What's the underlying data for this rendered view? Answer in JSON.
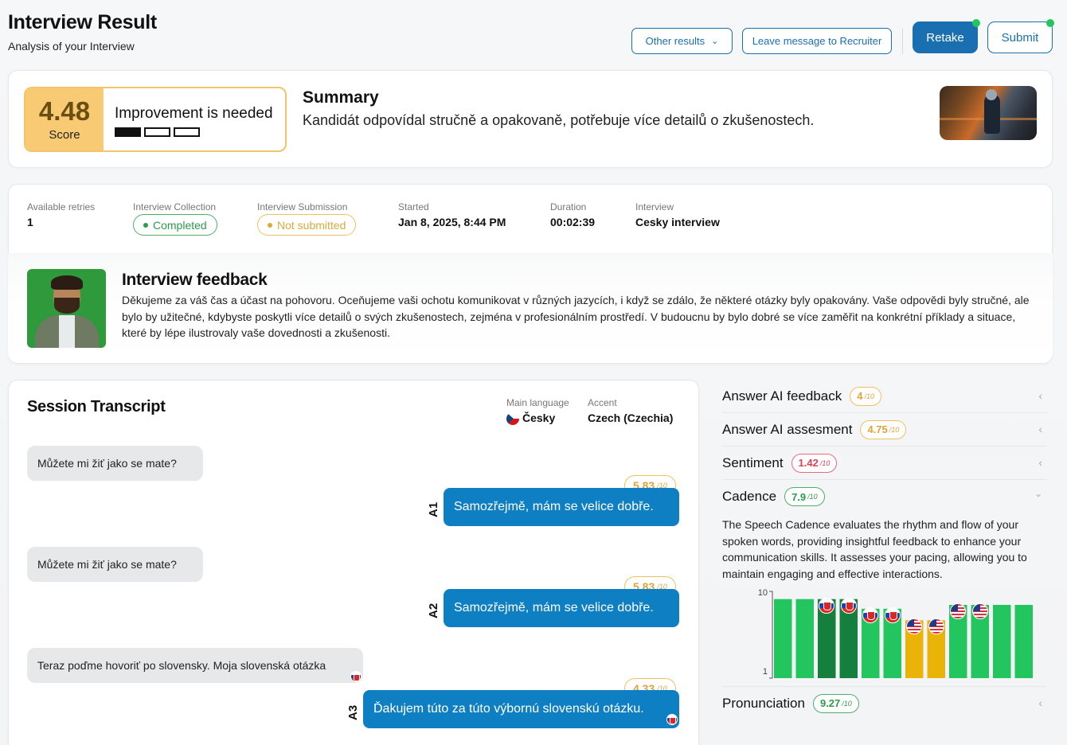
{
  "header": {
    "title": "Interview Result",
    "subtitle": "Analysis of your Interview",
    "other_results": "Other results",
    "leave_message": "Leave message to Recruiter",
    "retake": "Retake",
    "submit": "Submit"
  },
  "score": {
    "value": "4.48",
    "label": "Score",
    "status": "Improvement is needed",
    "level_filled": 1,
    "level_total": 3
  },
  "summary": {
    "title": "Summary",
    "text": "Kandidát odpovídal stručně a opakovaně, potřebuje více detailů o zkušenostech."
  },
  "meta": {
    "retries_label": "Available retries",
    "retries_value": "1",
    "collection_label": "Interview Collection",
    "collection_value": "Completed",
    "submission_label": "Interview Submission",
    "submission_value": "Not submitted",
    "started_label": "Started",
    "started_value": "Jan 8, 2025, 8:44 PM",
    "duration_label": "Duration",
    "duration_value": "00:02:39",
    "interview_label": "Interview",
    "interview_value": "Cesky interview"
  },
  "feedback": {
    "title": "Interview feedback",
    "text": "Děkujeme za váš čas a účast na pohovoru. Oceňujeme vaši ochotu komunikovat v různých jazycích, i když se zdálo, že některé otázky byly opakovány. Vaše odpovědi byly stručné, ale bylo by užitečné, kdybyste poskytli více detailů o svých zkušenostech, zejména v profesionálním prostředí. V budoucnu by bylo dobré se více zaměřit na konkrétní příklady a situace, které by lépe ilustrovaly vaše dovednosti a zkušenosti."
  },
  "transcript": {
    "title": "Session Transcript",
    "main_language_label": "Main language",
    "main_language_value": "Česky",
    "accent_label": "Accent",
    "accent_value": "Czech (Czechia)",
    "items": [
      {
        "question": "Můžete mi žiť jako se mate?",
        "answer_label": "A1",
        "answer": "Samozřejmě, mám se velice dobře.",
        "score": "5.83",
        "score_unit": "/10"
      },
      {
        "question": "Můžete mi žiť jako se mate?",
        "answer_label": "A2",
        "answer": "Samozřejmě, mám se velice dobře.",
        "score": "5.83",
        "score_unit": "/10"
      },
      {
        "question": "Teraz poďme hovoriť po slovensky. Moja slovenská otázka",
        "answer_label": "A3",
        "answer": "Ďakujem túto za túto výbornú slovenskú otázku.",
        "score": "4.33",
        "score_unit": "/10"
      }
    ]
  },
  "metrics": {
    "answer_feedback": {
      "label": "Answer AI feedback",
      "value": "4",
      "unit": "/10"
    },
    "answer_assessment": {
      "label": "Answer AI assesment",
      "value": "4.75",
      "unit": "/10"
    },
    "sentiment": {
      "label": "Sentiment",
      "value": "1.42",
      "unit": "/10"
    },
    "cadence": {
      "label": "Cadence",
      "value": "7.9",
      "unit": "/10",
      "description": "The Speech Cadence evaluates the rhythm and flow of your spoken words, providing insightful feedback to enhance your communication skills. It assesses your pacing, allowing you to maintain engaging and effective interactions."
    },
    "pronunciation": {
      "label": "Pronunciation",
      "value": "9.27",
      "unit": "/10"
    }
  },
  "chart_data": {
    "type": "bar",
    "ylim": [
      1,
      10
    ],
    "y_ticks": [
      "10",
      "1"
    ],
    "values": [
      9.2,
      9.2,
      9.2,
      9.2,
      8.2,
      8.2,
      7.0,
      7.0,
      8.6,
      8.6,
      8.6,
      8.6
    ],
    "colors": [
      "#22c55e",
      "#22c55e",
      "#15803d",
      "#15803d",
      "#22c55e",
      "#22c55e",
      "#eab308",
      "#eab308",
      "#22c55e",
      "#22c55e",
      "#22c55e",
      "#22c55e"
    ],
    "flags": [
      "",
      "",
      "sk",
      "sk",
      "sk",
      "sk",
      "us",
      "us",
      "us",
      "us",
      "",
      ""
    ],
    "grid": false
  },
  "colors": {
    "accent": "#1a6fb0",
    "answer_bubble": "#0f7fc4",
    "score_bg": "#f8ca74"
  }
}
